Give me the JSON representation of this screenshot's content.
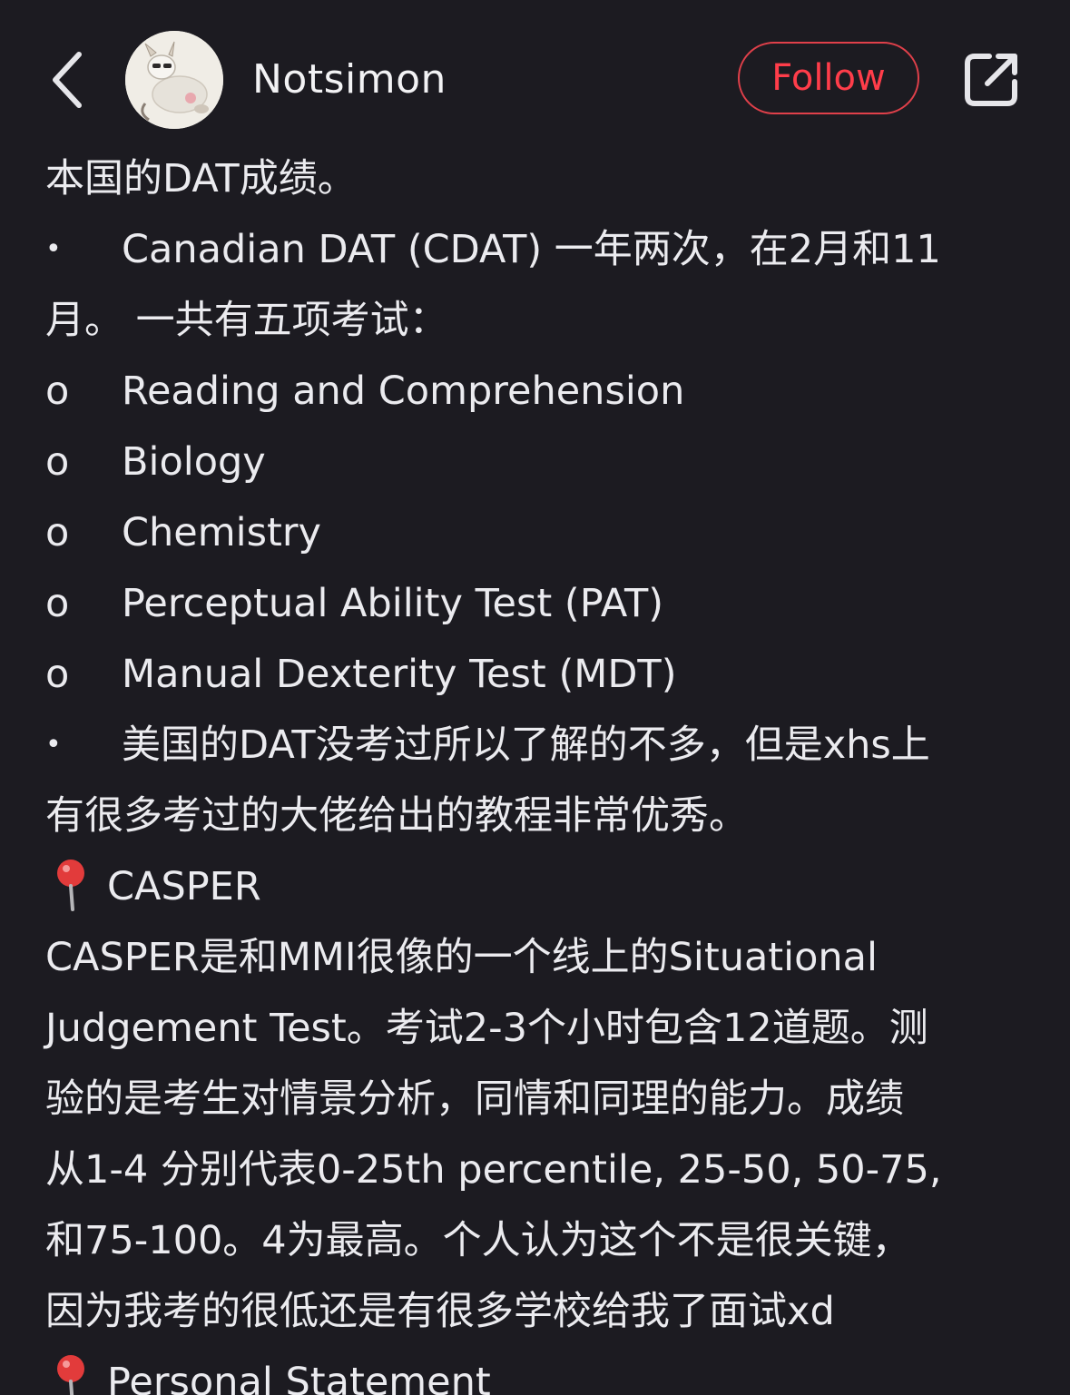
{
  "header": {
    "username": "Notsimon",
    "follow_label": "Follow",
    "icons": [
      "back-chevron-icon",
      "share-icon"
    ],
    "accent_color": "#ff3d4a"
  },
  "content": {
    "lines": [
      "本国的DAT成绩。",
      "Canadian DAT (CDAT) 一年两次，在2月和11",
      "月。 一共有五项考试：",
      "Reading and Comprehension",
      "Biology",
      "Chemistry",
      "Perceptual Ability Test (PAT)",
      "Manual Dexterity Test (MDT)",
      "美国的DAT没考过所以了解的不多，但是xhs上",
      "有很多考过的大佬给出的教程非常优秀。",
      "CASPER",
      "CASPER是和MMI很像的一个线上的Situational",
      "Judgement Test。考试2-3个小时包含12道题。测",
      "验的是考生对情景分析，同情和同理的能力。成绩",
      "从1-4 分别代表0-25th percentile, 25-50, 50-75,",
      "和75-100。4为最高。个人认为这个不是很关键，",
      "因为我考的很低还是有很多学校给我了面试xd",
      "Personal Statement"
    ],
    "markers": {
      "bullet": "•",
      "sub": "o"
    }
  }
}
